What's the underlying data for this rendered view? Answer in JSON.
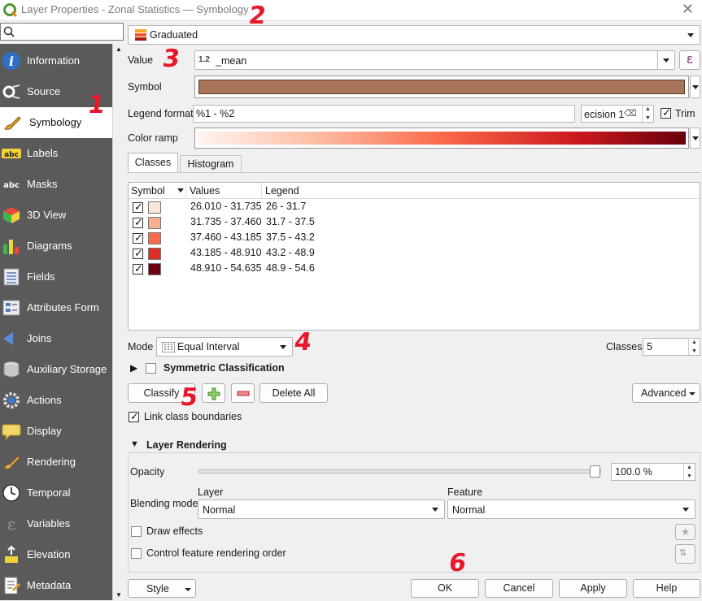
{
  "window": {
    "title": "Layer Properties - Zonal Statistics — Symbology"
  },
  "sidebar": {
    "items": [
      {
        "label": "Information",
        "icon": "info-icon"
      },
      {
        "label": "Source",
        "icon": "source-icon"
      },
      {
        "label": "Symbology",
        "icon": "paintbrush-icon"
      },
      {
        "label": "Labels",
        "icon": "labels-abc-icon"
      },
      {
        "label": "Masks",
        "icon": "masks-abc-icon"
      },
      {
        "label": "3D View",
        "icon": "cube-3d-icon"
      },
      {
        "label": "Diagrams",
        "icon": "diagrams-icon"
      },
      {
        "label": "Fields",
        "icon": "fields-icon"
      },
      {
        "label": "Attributes Form",
        "icon": "attributes-form-icon"
      },
      {
        "label": "Joins",
        "icon": "joins-icon"
      },
      {
        "label": "Auxiliary Storage",
        "icon": "database-icon"
      },
      {
        "label": "Actions",
        "icon": "actions-gear-icon"
      },
      {
        "label": "Display",
        "icon": "display-bubble-icon"
      },
      {
        "label": "Rendering",
        "icon": "rendering-brush-icon"
      },
      {
        "label": "Temporal",
        "icon": "clock-icon"
      },
      {
        "label": "Variables",
        "icon": "variables-epsilon-icon"
      },
      {
        "label": "Elevation",
        "icon": "elevation-icon"
      },
      {
        "label": "Metadata",
        "icon": "metadata-icon"
      }
    ]
  },
  "renderer": {
    "selected": "Graduated"
  },
  "value": {
    "prefix": "1.2",
    "field": "_mean",
    "expr_symbol": "ε"
  },
  "symbol": {
    "label": "Symbol",
    "color": "#a7745a"
  },
  "legend_format": {
    "label": "Legend format",
    "value": "%1 - %2",
    "precision_text": "ecision 1",
    "trim_label": "Trim"
  },
  "color_ramp": {
    "label": "Color ramp",
    "start": "#fff5f0",
    "end": "#67000d"
  },
  "value_label": "Value",
  "tabs": [
    "Classes",
    "Histogram"
  ],
  "classes_table": {
    "headers": [
      "Symbol",
      "Values",
      "Legend"
    ],
    "rows": [
      {
        "values": "26.010 - 31.735",
        "legend": "26 - 31.7",
        "color": "#fee5d9"
      },
      {
        "values": "31.735 - 37.460",
        "legend": "31.7 - 37.5",
        "color": "#fcae91"
      },
      {
        "values": "37.460 - 43.185",
        "legend": "37.5 - 43.2",
        "color": "#fb6a4a"
      },
      {
        "values": "43.185 - 48.910",
        "legend": "43.2 - 48.9",
        "color": "#de2d26"
      },
      {
        "values": "48.910 - 54.635",
        "legend": "48.9 - 54.6",
        "color": "#6b0010"
      }
    ]
  },
  "mode": {
    "label": "Mode",
    "selected": "Equal Interval"
  },
  "classes_count": {
    "label": "Classes",
    "value": "5"
  },
  "symmetric": {
    "label": "Symmetric Classification"
  },
  "buttons": {
    "classify": "Classify",
    "delete_all": "Delete All",
    "advanced": "Advanced",
    "style": "Style",
    "ok": "OK",
    "cancel": "Cancel",
    "apply": "Apply",
    "help": "Help"
  },
  "link_boundaries": {
    "label": "Link class boundaries"
  },
  "layer_rendering": {
    "title": "Layer Rendering",
    "opacity_label": "Opacity",
    "opacity_value": "100.0 %",
    "opacity": 1.0,
    "blending_label": "Blending mode",
    "layer_label": "Layer",
    "feature_label": "Feature",
    "layer_blend": "Normal",
    "feature_blend": "Normal",
    "draw_effects": "Draw effects",
    "control_order": "Control feature rendering order"
  },
  "annotations": [
    "1",
    "2",
    "3",
    "4",
    "5",
    "6"
  ]
}
